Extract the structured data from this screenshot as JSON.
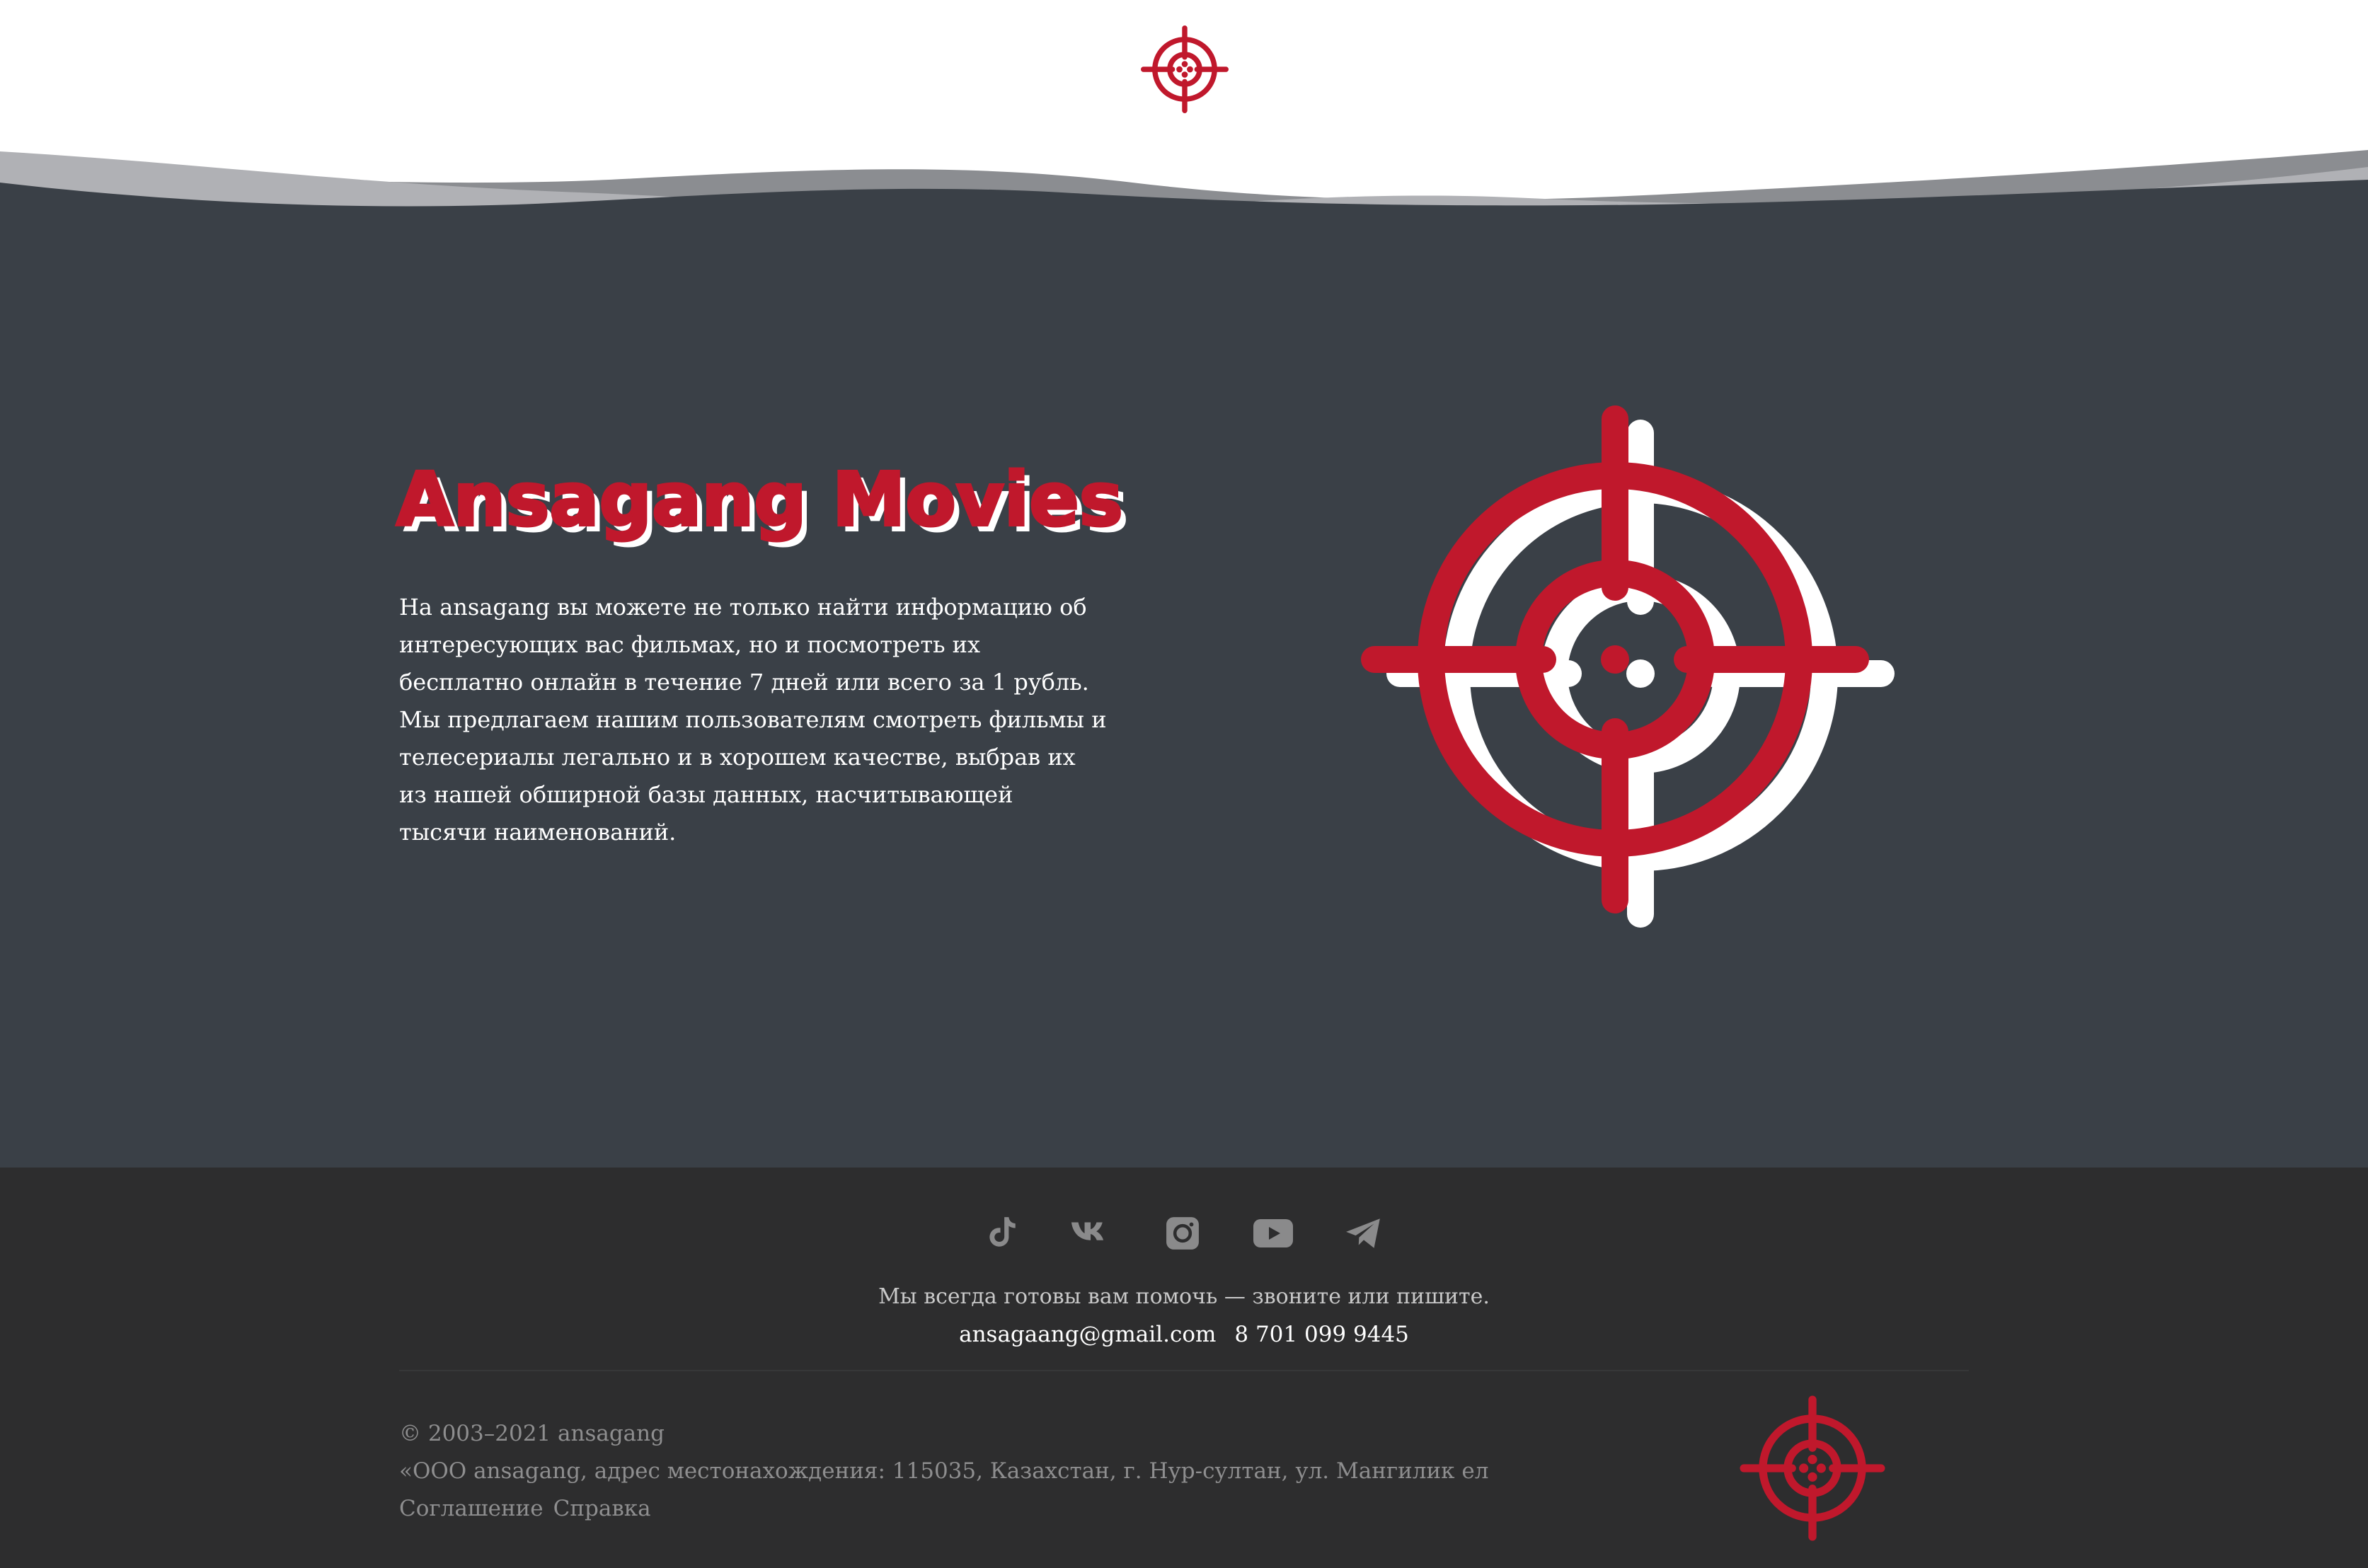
{
  "colors": {
    "accent": "#c0182c",
    "hero_bg": "#3a4047",
    "footer_bg": "#2d2d2e",
    "header_bg": "#ffffff",
    "wave_light": "#b0b1b5",
    "wave_dark": "#8b8d91"
  },
  "header": {
    "logo_icon": "crosshair-icon"
  },
  "hero": {
    "title": "Ansagang Movies",
    "description": "На ansagang вы можете не только найти информацию об интересующих вас фильмах, но и посмотреть их бесплатно онлайн в течение 7 дней или всего за 1 рубль. Мы предлагаем нашим пользователям смотреть фильмы и телесериалы легально и в хорошем качестве, выбрав их из нашей обширной базы данных, насчитывающей тысячи наименований.",
    "illustration_icon": "crosshair-icon"
  },
  "footer": {
    "socials": [
      {
        "name": "tiktok-icon"
      },
      {
        "name": "vk-icon"
      },
      {
        "name": "instagram-icon"
      },
      {
        "name": "youtube-icon"
      },
      {
        "name": "telegram-icon"
      }
    ],
    "help_text": "Мы всегда готовы вам помочь — звоните или пишите.",
    "email": "ansagaang@gmail.com",
    "phone": "8 701 099 9445",
    "copyright": "© 2003–2021 ansagang",
    "address": "«ООО ansagang, адрес местонахождения: 115035, Казахстан, г. Нур-султан, ул. Мангилик ел",
    "links": [
      {
        "label": "Соглашение"
      },
      {
        "label": "Справка"
      }
    ],
    "logo_icon": "crosshair-icon"
  }
}
